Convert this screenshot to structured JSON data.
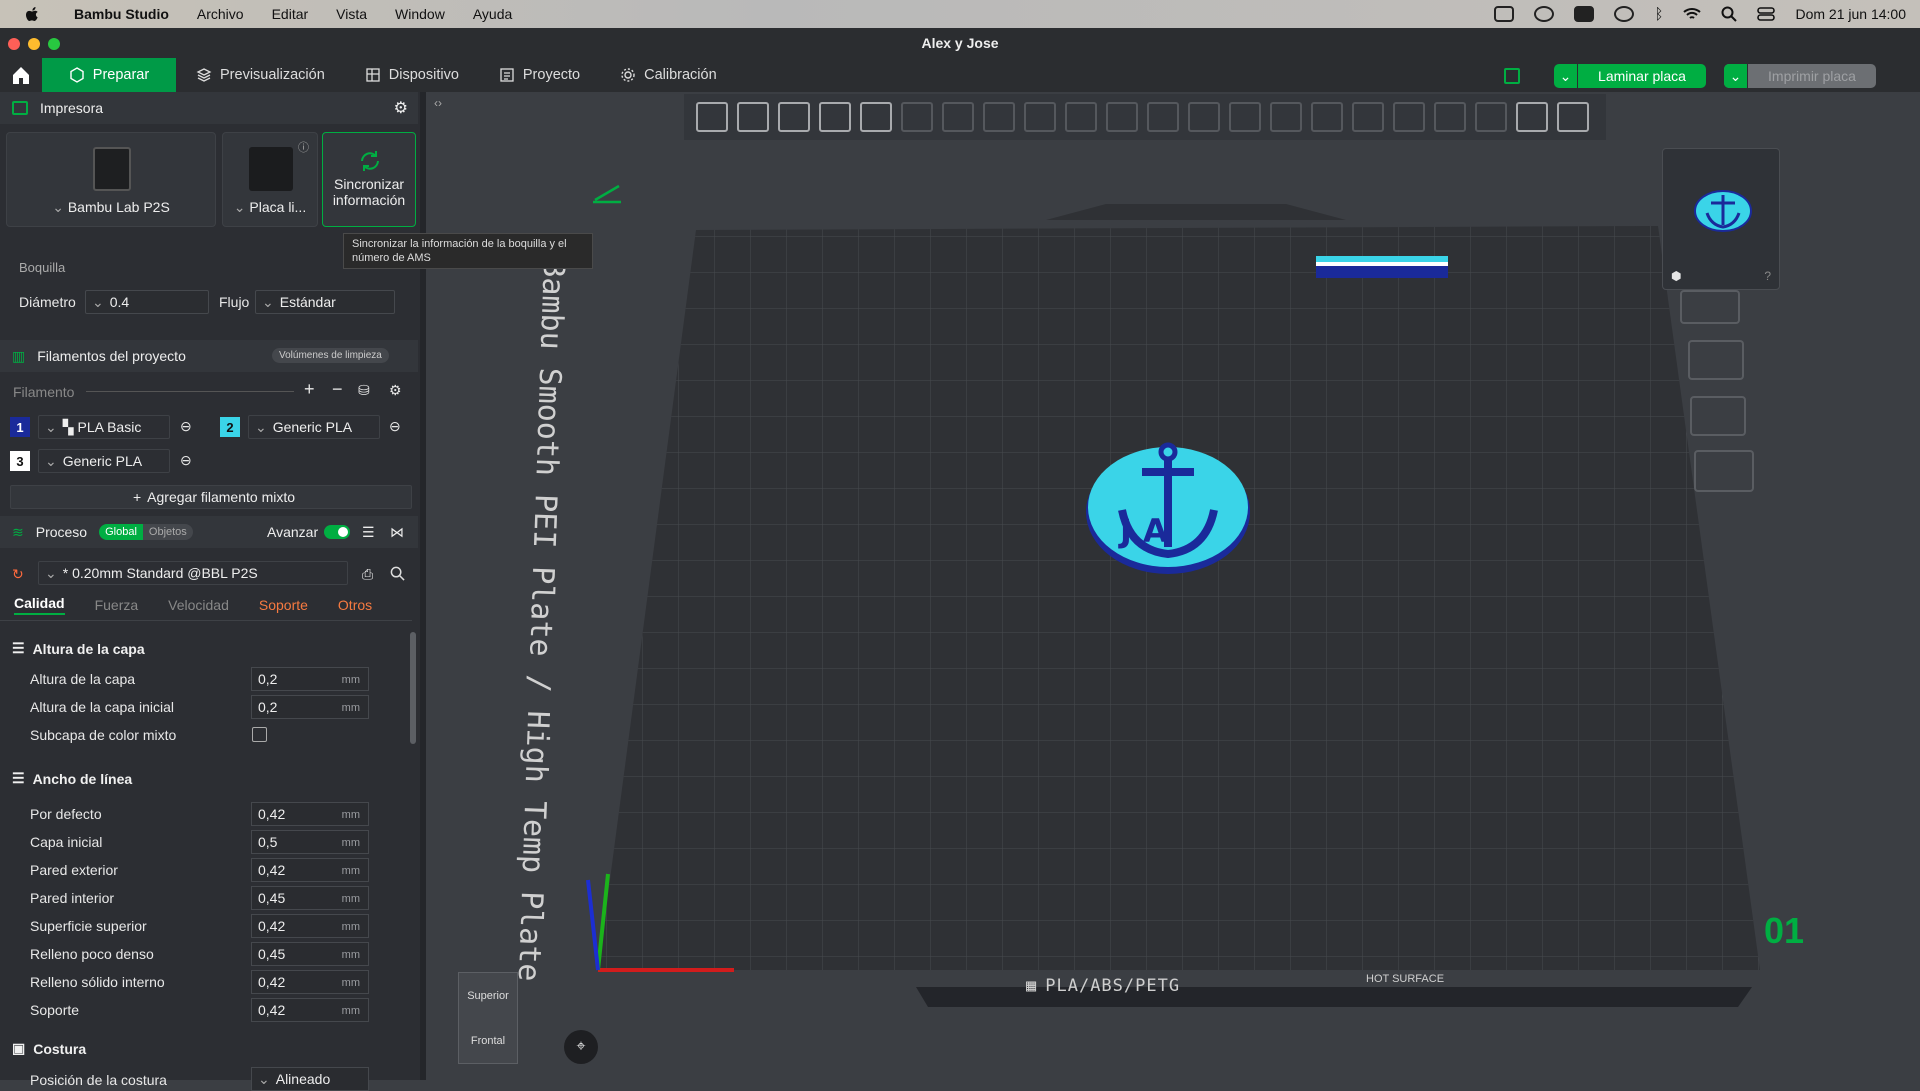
{
  "menubar": {
    "app": "Bambu Studio",
    "items": [
      "Archivo",
      "Editar",
      "Vista",
      "Window",
      "Ayuda"
    ],
    "clock": "Dom 21 jun 14:00"
  },
  "window": {
    "title": "Alex y Jose"
  },
  "tabs": [
    {
      "label": "Preparar"
    },
    {
      "label": "Previsualización"
    },
    {
      "label": "Dispositivo"
    },
    {
      "label": "Proyecto"
    },
    {
      "label": "Calibración"
    }
  ],
  "actions": {
    "slice": "Laminar placa",
    "print": "Imprimir placa"
  },
  "printer": {
    "header": "Impresora",
    "printer_name": "Bambu Lab P2S",
    "plate_name": "Placa li...",
    "sync_label_1": "Sincronizar",
    "sync_label_2": "información",
    "tooltip": "Sincronizar la información de la boquilla y el número de AMS"
  },
  "nozzle": {
    "header": "Boquilla",
    "diameter_label": "Diámetro",
    "diameter": "0.4",
    "flow_label": "Flujo",
    "flow": "Estándar"
  },
  "filaments": {
    "header": "Filamentos del proyecto",
    "flush": "Volúmenes de limpieza",
    "label": "Filamento",
    "items": [
      {
        "num": "1",
        "name": "PLA Basic",
        "color": "#1a2a9a"
      },
      {
        "num": "2",
        "name": "Generic PLA",
        "color": "#3ad4e8"
      },
      {
        "num": "3",
        "name": "Generic PLA",
        "color": "#ffffff"
      }
    ],
    "add_mixed": "Agregar filamento mixto"
  },
  "process": {
    "header": "Proceso",
    "global": "Global",
    "objects": "Objetos",
    "advanced": "Avanzar",
    "preset": "* 0.20mm Standard @BBL P2S",
    "subtabs": [
      "Calidad",
      "Fuerza",
      "Velocidad",
      "Soporte",
      "Otros"
    ]
  },
  "settings": {
    "layer_height": {
      "title": "Altura de la capa",
      "rows": [
        {
          "label": "Altura de la capa",
          "value": "0,2",
          "unit": "mm"
        },
        {
          "label": "Altura de la capa inicial",
          "value": "0,2",
          "unit": "mm"
        }
      ],
      "checkbox_label": "Subcapa de color mixto"
    },
    "line_width": {
      "title": "Ancho de línea",
      "rows": [
        {
          "label": "Por defecto",
          "value": "0,42",
          "unit": "mm"
        },
        {
          "label": "Capa inicial",
          "value": "0,5",
          "unit": "mm"
        },
        {
          "label": "Pared exterior",
          "value": "0,42",
          "unit": "mm"
        },
        {
          "label": "Pared interior",
          "value": "0,45",
          "unit": "mm"
        },
        {
          "label": "Superficie superior",
          "value": "0,42",
          "unit": "mm"
        },
        {
          "label": "Relleno poco denso",
          "value": "0,45",
          "unit": "mm"
        },
        {
          "label": "Relleno sólido interno",
          "value": "0,42",
          "unit": "mm"
        },
        {
          "label": "Soporte",
          "value": "0,42",
          "unit": "mm"
        }
      ]
    },
    "seam": {
      "title": "Costura",
      "row_label": "Posición de la costura",
      "row_value": "Alineado"
    }
  },
  "plate": {
    "side_text": "Bambu Smooth PEI Plate / High Temp Plate",
    "bottom_text": "PLA/ABS/PETG",
    "hot_surface": "HOT SURFACE",
    "plate_number": "01",
    "view_top": "Superior",
    "view_front": "Frontal",
    "model_letters": "J A"
  }
}
